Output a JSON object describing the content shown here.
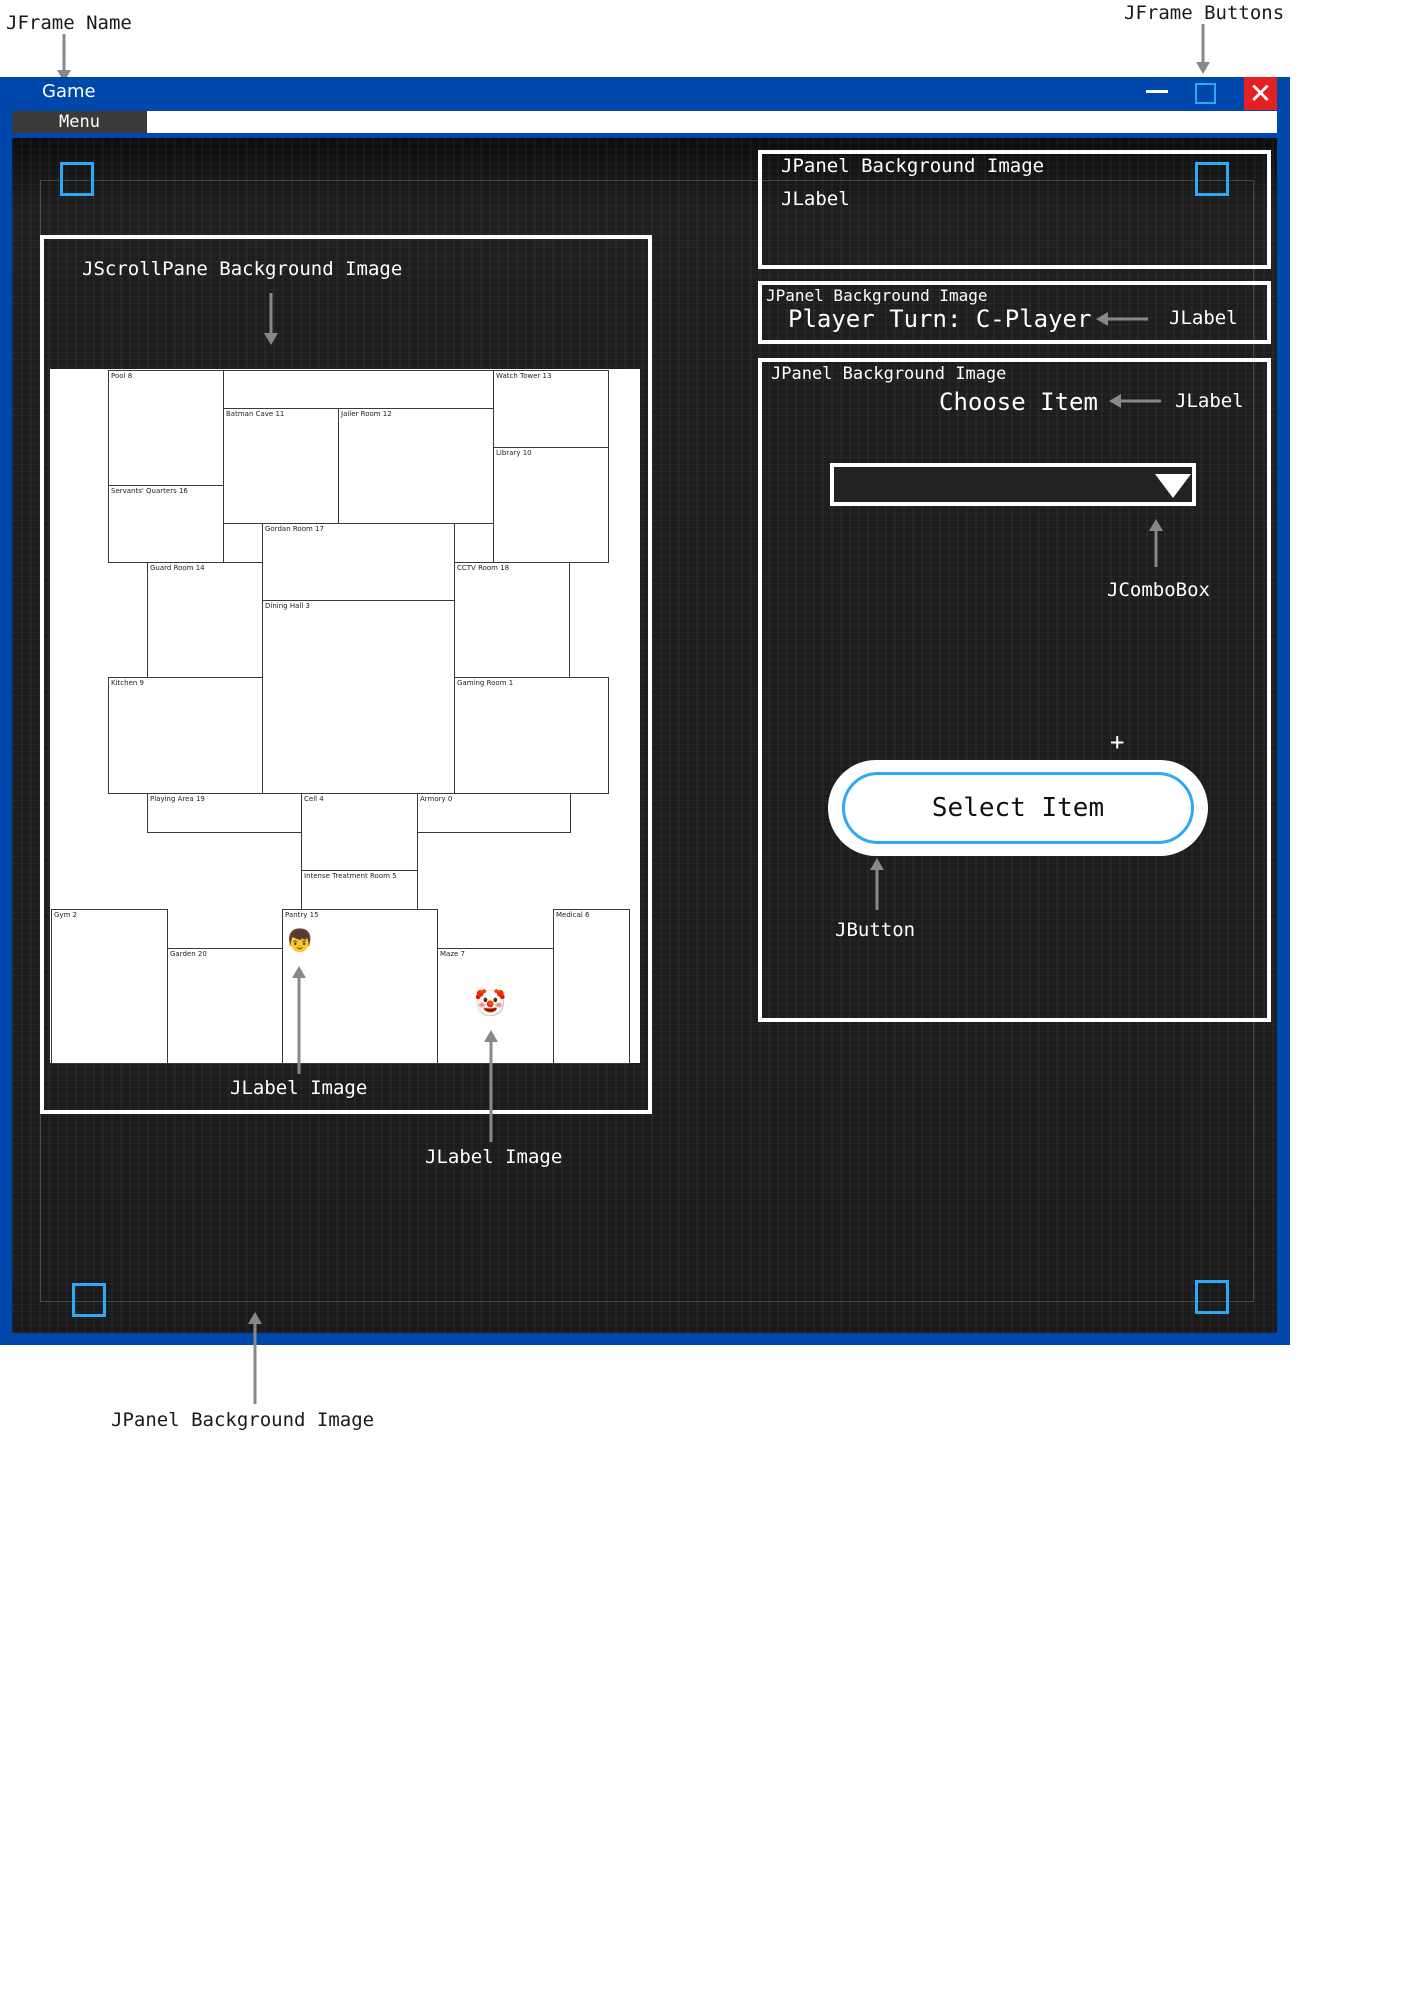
{
  "annotations": {
    "jframe_name": "JFrame Name",
    "jframe_buttons": "JFrame Buttons",
    "jpanel_bg_bottom": "JPanel Background Image",
    "jlabel_image_1": "JLabel Image",
    "jlabel_image_2": "JLabel Image",
    "jscrollpane": "JScrollPane Background Image",
    "panel1_title": "JPanel Background Image",
    "panel1_label": "JLabel",
    "panel2_title": "JPanel Background Image",
    "panel2_label": "JLabel",
    "panel3_title": "JPanel Background Image",
    "panel3_label": "JLabel",
    "jcombobox": "JComboBox",
    "jbutton": "JButton"
  },
  "window": {
    "title": "Game",
    "menu": "Menu",
    "close_glyph": "✕"
  },
  "game": {
    "player_turn": "Player Turn: C-Player",
    "choose_item": "Choose Item",
    "select_item_button": "Select Item",
    "plus": "+"
  },
  "map": {
    "rooms": [
      "Pool 8",
      "Watch Tower 13",
      "Batman Cave 11",
      "Jailer Room 12",
      "Library 10",
      "Servants' Quarters 16",
      "Gordan Room 17",
      "Guard Room 14",
      "CCTV Room 18",
      "Dining Hall 3",
      "Kitchen 9",
      "Gaming Room 1",
      "Playing Area 19",
      "Cell 4",
      "Armory 0",
      "Intense Treatment Room 5",
      "Gym 2",
      "Pantry 15",
      "Medical 6",
      "Garden 20",
      "Maze 7"
    ],
    "player_icon": "👦",
    "joker_icon": "🤡"
  },
  "colors": {
    "frame_blue": "#0047ab",
    "accent_blue": "#2da9f5",
    "close_red": "#e52020",
    "panel_dark": "#1e1e1e"
  }
}
